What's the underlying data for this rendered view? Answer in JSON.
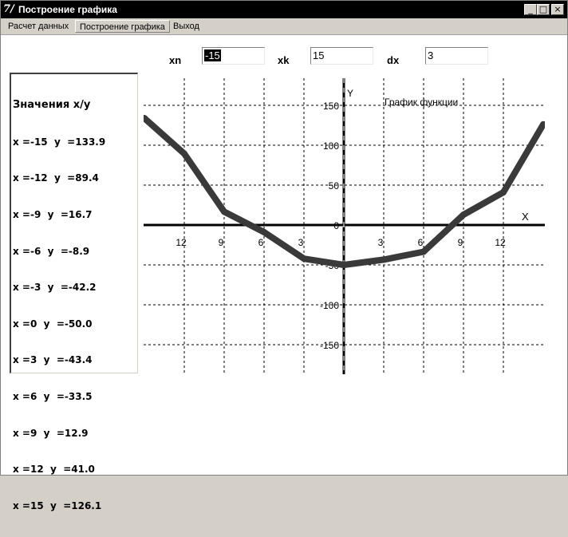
{
  "window": {
    "title": "Построение графика",
    "app_icon": "delphi-7-icon",
    "controls": {
      "minimize": "_",
      "maximize": "□",
      "close": "×"
    }
  },
  "menu": [
    {
      "label": "Расчет данных",
      "active": false
    },
    {
      "label": "Построение графика",
      "active": true
    },
    {
      "label": "Выход",
      "active": false
    }
  ],
  "inputs": {
    "xn": {
      "label": "xn",
      "value": "-15"
    },
    "xk": {
      "label": "xk",
      "value": "15"
    },
    "dx": {
      "label": "dx",
      "value": "3"
    }
  },
  "values_list": {
    "title": "Значения x/y",
    "items": [
      "x =-15  y  =133.9",
      "x =-12  y  =89.4",
      "x =-9  y  =16.7",
      "x =-6  y  =-8.9",
      "x =-3  y  =-42.2",
      "x =0  y  =-50.0",
      "x =3  y  =-43.4",
      "x =6  y  =-33.5",
      "x =9  y  =12.9",
      "x =12  y  =41.0",
      "x =15  y  =126.1"
    ]
  },
  "chart_data": {
    "type": "line",
    "title": "График функции",
    "xlabel": "X",
    "ylabel": "Y",
    "x": [
      -15,
      -12,
      -9,
      -6,
      -3,
      0,
      3,
      6,
      9,
      12,
      15
    ],
    "series": [
      {
        "values": [
          133.9,
          89.4,
          16.7,
          -8.9,
          -42.2,
          -50.0,
          -43.4,
          -33.5,
          12.9,
          41.0,
          126.1
        ]
      }
    ],
    "xlim": [
      -15,
      15
    ],
    "ylim": [
      -190,
      180
    ],
    "x_ticks": [
      {
        "value": -12,
        "label": "12"
      },
      {
        "value": -9,
        "label": "9"
      },
      {
        "value": -6,
        "label": "6"
      },
      {
        "value": -3,
        "label": "3"
      },
      {
        "value": 3,
        "label": "3"
      },
      {
        "value": 6,
        "label": "6"
      },
      {
        "value": 9,
        "label": "9"
      },
      {
        "value": 12,
        "label": "12"
      }
    ],
    "y_ticks": [
      {
        "value": 150,
        "label": "150"
      },
      {
        "value": 100,
        "label": "100"
      },
      {
        "value": 50,
        "label": "50"
      },
      {
        "value": 0,
        "label": "0"
      },
      {
        "value": -50,
        "label": "-50"
      },
      {
        "value": -100,
        "label": "-100"
      },
      {
        "value": -150,
        "label": "-150"
      }
    ],
    "grid": true,
    "line_color": "#3a3a3a",
    "axis_color": "#000000"
  }
}
